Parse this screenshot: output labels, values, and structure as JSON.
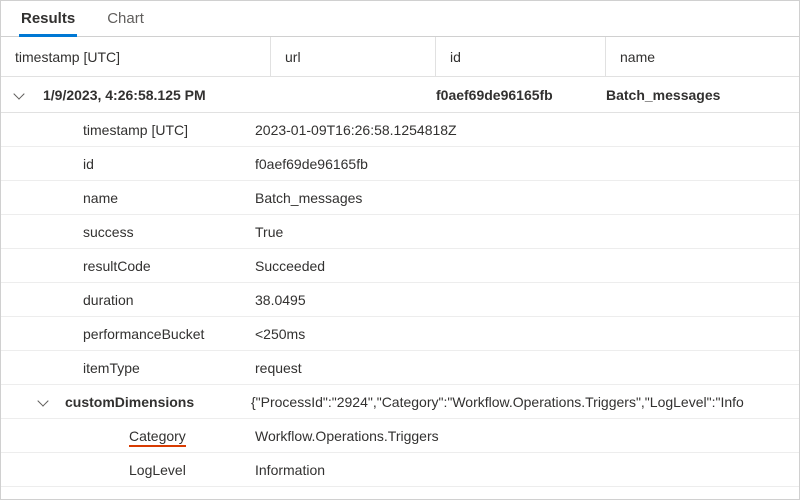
{
  "tabs": {
    "results": "Results",
    "chart": "Chart"
  },
  "columns": {
    "timestamp": "timestamp [UTC]",
    "url": "url",
    "id": "id",
    "name": "name"
  },
  "row": {
    "timestamp": "1/9/2023, 4:26:58.125 PM",
    "url": "",
    "id": "f0aef69de96165fb",
    "name": "Batch_messages"
  },
  "details": {
    "timestamp_label": "timestamp [UTC]",
    "timestamp_value": "2023-01-09T16:26:58.1254818Z",
    "id_label": "id",
    "id_value": "f0aef69de96165fb",
    "name_label": "name",
    "name_value": "Batch_messages",
    "success_label": "success",
    "success_value": "True",
    "resultCode_label": "resultCode",
    "resultCode_value": "Succeeded",
    "duration_label": "duration",
    "duration_value": "38.0495",
    "performanceBucket_label": "performanceBucket",
    "performanceBucket_value": "<250ms",
    "itemType_label": "itemType",
    "itemType_value": "request",
    "customDimensions_label": "customDimensions",
    "customDimensions_value": "{\"ProcessId\":\"2924\",\"Category\":\"Workflow.Operations.Triggers\",\"LogLevel\":\"Info",
    "cd_category_label": "Category",
    "cd_category_value": "Workflow.Operations.Triggers",
    "cd_loglevel_label": "LogLevel",
    "cd_loglevel_value": "Information"
  }
}
